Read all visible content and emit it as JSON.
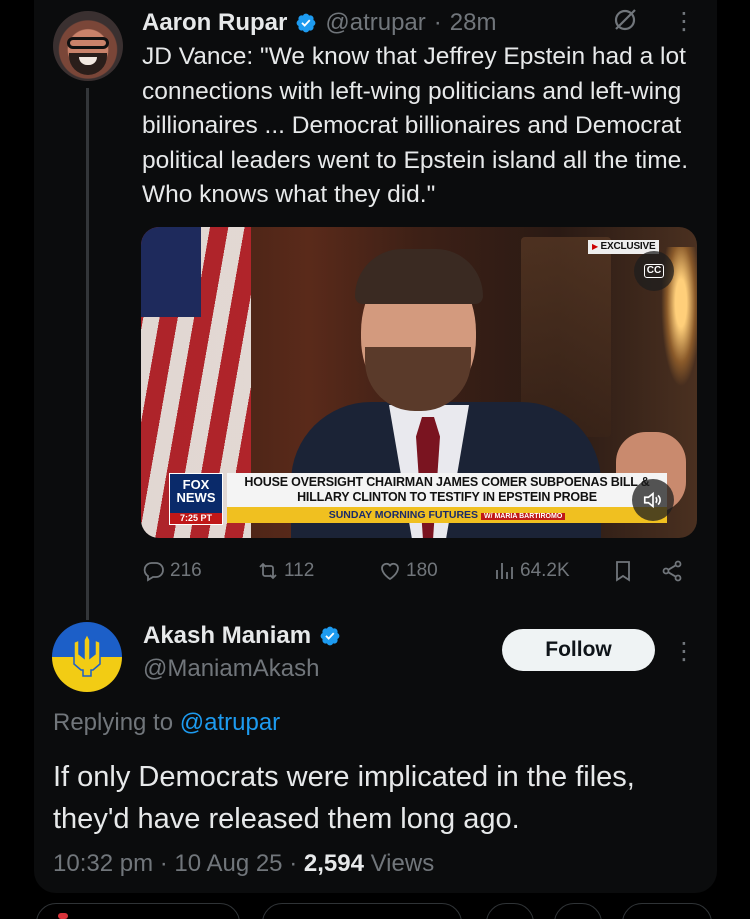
{
  "tweet1": {
    "author_name": "Aaron Rupar",
    "handle": "@atrupar",
    "separator": "·",
    "time": "28m",
    "text": "JD Vance: \"We know that Jeffrey Epstein had a lot connections with left-wing politicians and left-wing billionaires ... Democrat billionaires and Democrat political leaders went to Epstein island all the time. Who knows what they did.\"",
    "video": {
      "badge": "EXCLUSIVE",
      "cc_label": "CC",
      "network_logo": "FOX NEWS",
      "time_chip": "7:25 PT",
      "headline": "HOUSE OVERSIGHT CHAIRMAN JAMES COMER SUBPOENAS BILL & HILLARY CLINTON TO TESTIFY IN EPSTEIN PROBE",
      "ticker": "SUNDAY MORNING FUTURES",
      "ticker_host": "W/ MARIA BARTIROMO"
    },
    "stats": {
      "replies": "216",
      "reposts": "112",
      "likes": "180",
      "views": "64.2K"
    }
  },
  "tweet2": {
    "author_name": "Akash Maniam",
    "handle": "@ManiamAkash",
    "follow_label": "Follow",
    "replying_prefix": "Replying to",
    "replying_to": "@atrupar",
    "text": "If only Democrats were implicated in the files, they'd have released them long ago.",
    "time": "10:32 pm",
    "date": "10 Aug 25",
    "views_count": "2,594",
    "views_label": "Views",
    "separator": "·"
  },
  "colors": {
    "background": "#000000",
    "card": "#0b0c0d",
    "text_primary": "#e7e9ea",
    "text_secondary": "#71767b",
    "accent": "#1d9bf0",
    "verified": "#1d9bf0"
  },
  "icons": [
    "verified-badge-icon",
    "grok-icon",
    "more-icon",
    "reply-icon",
    "repost-icon",
    "like-icon",
    "views-icon",
    "bookmark-icon",
    "share-icon",
    "cc-icon",
    "volume-icon"
  ]
}
